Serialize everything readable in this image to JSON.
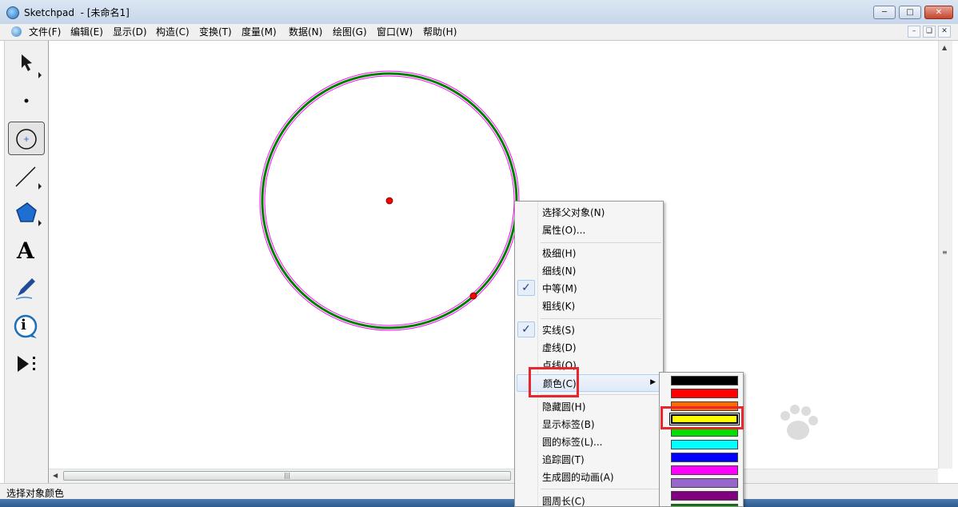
{
  "window": {
    "app_name": "Sketchpad",
    "doc_title": "- [未命名1]"
  },
  "menus": [
    "文件(F)",
    "编辑(E)",
    "显示(D)",
    "构造(C)",
    "变换(T)",
    "度量(M)",
    "数据(N)",
    "绘图(G)",
    "窗口(W)",
    "帮助(H)"
  ],
  "toolbox": {
    "tools": [
      {
        "name": "selection-arrow-tool",
        "active": false
      },
      {
        "name": "point-tool",
        "active": false
      },
      {
        "name": "compass-tool",
        "active": true
      },
      {
        "name": "straightedge-tool",
        "active": false
      },
      {
        "name": "polygon-tool",
        "active": false
      },
      {
        "name": "text-tool",
        "active": false,
        "glyph": "A"
      },
      {
        "name": "marker-tool",
        "active": false
      },
      {
        "name": "information-tool",
        "active": false,
        "glyph": "i"
      },
      {
        "name": "custom-tool",
        "active": false
      }
    ]
  },
  "context_menu": {
    "items": [
      {
        "label": "选择父对象(N)",
        "checked": false
      },
      {
        "label": "属性(O)...",
        "checked": false
      },
      {
        "label": "极细(H)",
        "checked": false
      },
      {
        "label": "细线(N)",
        "checked": false
      },
      {
        "label": "中等(M)",
        "checked": true
      },
      {
        "label": "粗线(K)",
        "checked": false
      },
      {
        "label": "实线(S)",
        "checked": true
      },
      {
        "label": "虚线(D)",
        "checked": false
      },
      {
        "label": "点线(O)",
        "checked": false
      },
      {
        "label": "颜色(C)",
        "checked": false,
        "highlighted": true,
        "submenu": true
      },
      {
        "label": "隐藏圆(H)",
        "checked": false
      },
      {
        "label": "显示标签(B)",
        "checked": false
      },
      {
        "label": "圆的标签(L)...",
        "checked": false
      },
      {
        "label": "追踪圆(T)",
        "checked": false
      },
      {
        "label": "生成圆的动画(A)",
        "checked": false
      },
      {
        "label": "圆周长(C)",
        "checked": false
      }
    ]
  },
  "color_menu": {
    "swatches": [
      "#000000",
      "#ff0000",
      "#ff6a00",
      "#ffff00",
      "#00e000",
      "#00ffff",
      "#0000ff",
      "#ff00ff",
      "#9966cc",
      "#800080",
      "#008000"
    ],
    "selected_index": 3
  },
  "status": {
    "text": "选择对象颜色"
  },
  "colors": {
    "circle_outer": "#ff00ff",
    "circle_inner": "#008000",
    "point": "#ff0000",
    "annotation_red": "#e8262e"
  }
}
